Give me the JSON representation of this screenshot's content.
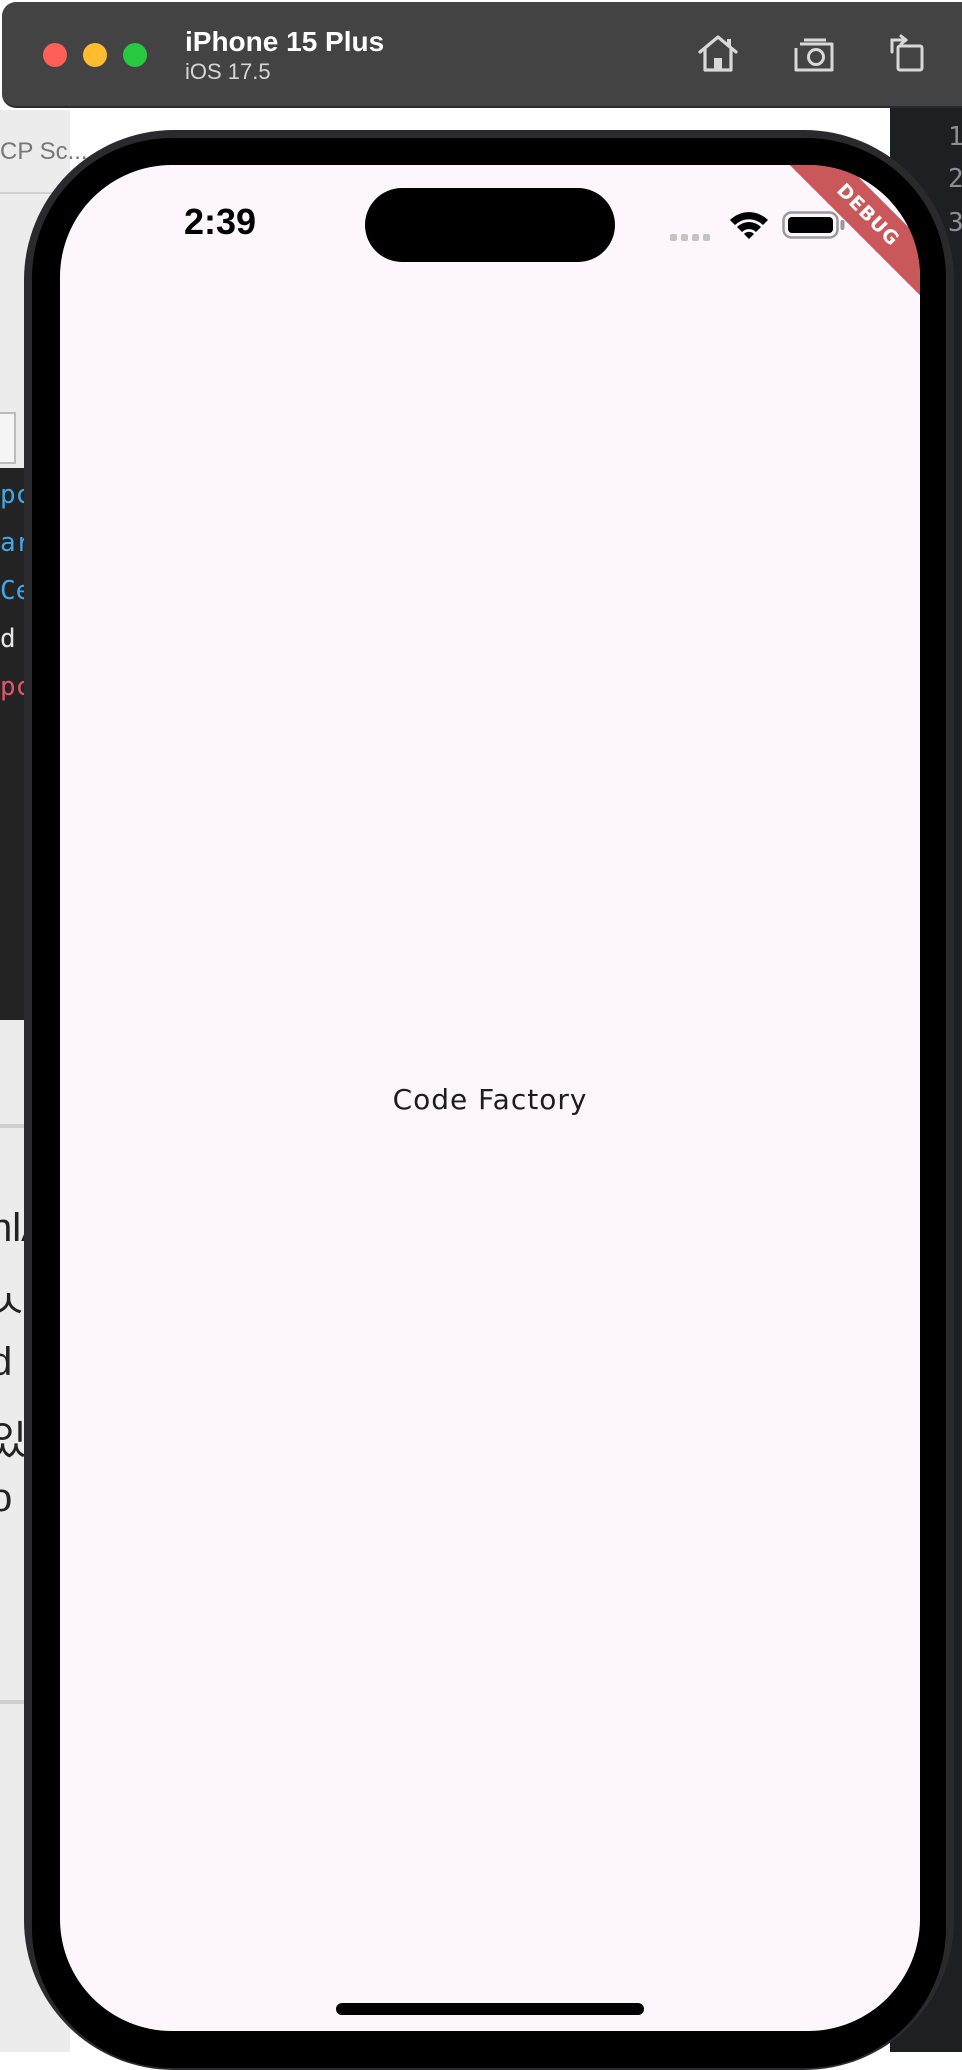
{
  "simulator": {
    "device_name": "iPhone 15 Plus",
    "os_version": "iOS 17.5",
    "toolbar": {
      "home_icon": "home-icon",
      "screenshot_icon": "camera-icon",
      "rotate_icon": "rotate-icon"
    }
  },
  "background": {
    "left_tab_text": "CP Sc...",
    "code_fragments": [
      "pc",
      "ar",
      "Ce",
      "d",
      "pc"
    ],
    "large_text_fragments": [
      "nlA",
      "ㅅ",
      "d",
      "있",
      "o"
    ],
    "line_numbers": [
      "1",
      "2",
      "3"
    ]
  },
  "status_bar": {
    "time": "2:39",
    "wifi_icon": "wifi-icon",
    "battery_icon": "battery-icon"
  },
  "app": {
    "debug_banner": "DEBUG",
    "center_text": "Code Factory",
    "background_color": "#fdf7fd"
  },
  "colors": {
    "debug_banner": "#b82323",
    "titlebar": "#434343"
  }
}
